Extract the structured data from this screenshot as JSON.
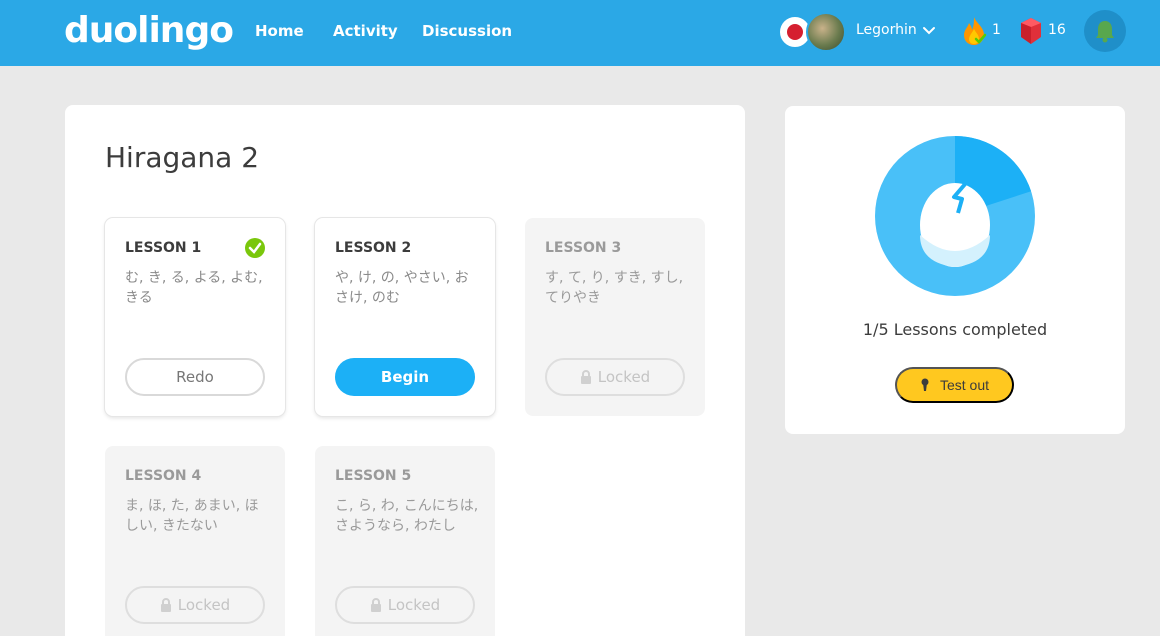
{
  "header": {
    "logo": "duolingo",
    "nav": [
      {
        "label": "Home"
      },
      {
        "label": "Activity"
      },
      {
        "label": "Discussion"
      }
    ],
    "username": "Legorhin",
    "streak": "1",
    "gems": "16",
    "colors": {
      "bar": "#2ba8e6",
      "bell": "#1f8fc9"
    },
    "icons": {
      "flag": "flag-japan-icon",
      "streak": "fire-icon",
      "gems": "gem-icon",
      "bell": "bell-icon"
    }
  },
  "page": {
    "title": "Hiragana 2"
  },
  "lessons": [
    {
      "title": "LESSON 1",
      "words": "む, き, る, よる, よむ, きる",
      "button": "Redo",
      "state": "completed"
    },
    {
      "title": "LESSON 2",
      "words": "や, け, の, やさい, おさけ, のむ",
      "button": "Begin",
      "state": "active"
    },
    {
      "title": "LESSON 3",
      "words": "す, て, り, すき, すし, てりやき",
      "button": "Locked",
      "state": "locked"
    },
    {
      "title": "LESSON 4",
      "words": "ま, ほ, た, あまい, ほしい, きたない",
      "button": "Locked",
      "state": "locked"
    },
    {
      "title": "LESSON 5",
      "words": "こ, ら, わ, こんにちは, さようなら, わたし",
      "button": "Locked",
      "state": "locked"
    }
  ],
  "progress": {
    "completed": 1,
    "total": 5,
    "text": "1/5 Lessons completed",
    "test_out": "Test out",
    "colors": {
      "ring": "#49c0f8",
      "done": "#1cb0f6",
      "button": "#ffc81f"
    }
  }
}
